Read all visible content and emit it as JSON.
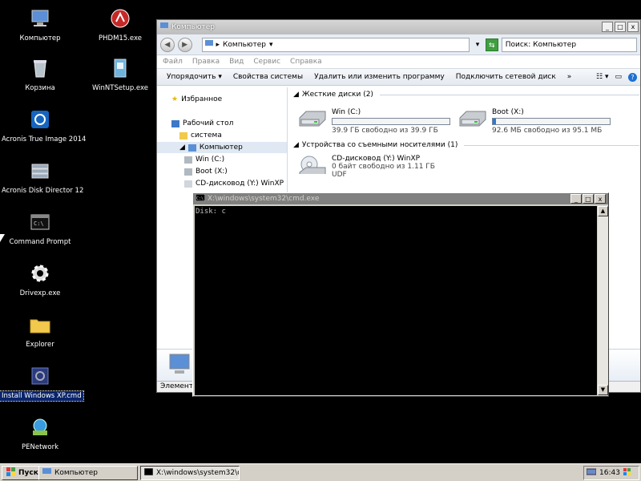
{
  "desktop": {
    "icons": [
      {
        "label": "Компьютер",
        "icon": "computer-icon"
      },
      {
        "label": "PHDM15.exe",
        "icon": "phdm-icon"
      },
      {
        "label": "Корзина",
        "icon": "recycle-bin-icon"
      },
      {
        "label": "WinNTSetup.exe",
        "icon": "winntsetup-icon"
      },
      {
        "label": "Acronis True Image 2014",
        "icon": "acronis-true-image-icon"
      },
      {
        "label": "Acronis Disk Director 12",
        "icon": "acronis-disk-director-icon"
      },
      {
        "label": "Command Prompt",
        "icon": "command-prompt-icon"
      },
      {
        "label": "Drivexp.exe",
        "icon": "gear-icon"
      },
      {
        "label": "Explorer",
        "icon": "folder-icon"
      },
      {
        "label": "Install Windows XP.cmd",
        "icon": "cmd-file-icon"
      },
      {
        "label": "PENetwork",
        "icon": "network-icon"
      }
    ]
  },
  "explorer": {
    "title": "Компьютер",
    "address": "Компьютер",
    "search_placeholder": "Поиск: Компьютер",
    "menu": [
      "Файл",
      "Правка",
      "Вид",
      "Сервис",
      "Справка"
    ],
    "commands": [
      "Упорядочить",
      "Свойства системы",
      "Удалить или изменить программу",
      "Подключить сетевой диск",
      "»"
    ],
    "nav": {
      "favorites": "Избранное",
      "desktop": "Рабочий стол",
      "system": "система",
      "computer": "Компьютер",
      "drive_c": "Win (C:)",
      "drive_x": "Boot (X:)",
      "cd": "CD-дисковод (Y:) WinXP"
    },
    "groups": {
      "hard_disks": "Жесткие диски (2)",
      "removable": "Устройства со съемными носителями (1)"
    },
    "drives": [
      {
        "name": "Win (C:)",
        "info": "39.9 ГБ свободно из 39.9 ГБ",
        "used": 0.0
      },
      {
        "name": "Boot (X:)",
        "info": "92.6 МБ свободно из 95.1 МБ",
        "used": 0.03
      }
    ],
    "cd": {
      "name": "CD-дисковод (Y:) WinXP",
      "info": "0 байт свободно из 1.11 ГБ",
      "fs": "UDF"
    },
    "status": "Элементов"
  },
  "cmd": {
    "title": "X:\\windows\\system32\\cmd.exe",
    "lines": [
      "Disk: c"
    ]
  },
  "taskbar": {
    "start_label": "Пуск",
    "tasks": [
      "Компьютер",
      "X:\\windows\\system32\\c..."
    ],
    "clock": "16:43"
  },
  "colors": {
    "selection": "#0a246a",
    "progress": "#2a7bd3",
    "taskbar": "#d4d0c8"
  }
}
